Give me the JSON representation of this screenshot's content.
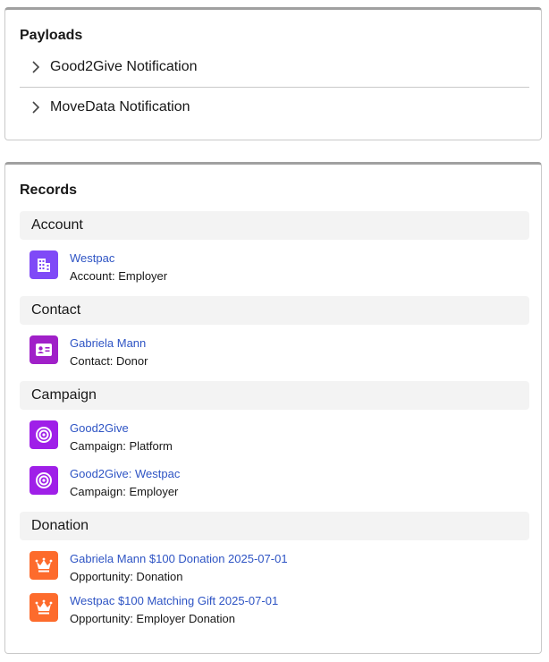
{
  "payloads": {
    "title": "Payloads",
    "items": [
      {
        "label": "Good2Give Notification"
      },
      {
        "label": "MoveData Notification"
      }
    ]
  },
  "records": {
    "title": "Records",
    "sections": [
      {
        "header": "Account",
        "items": [
          {
            "name": "Westpac",
            "subtitle": "Account: Employer",
            "icon": "building-icon",
            "color": "#7f4af7"
          }
        ]
      },
      {
        "header": "Contact",
        "items": [
          {
            "name": "Gabriela Mann",
            "subtitle": "Contact: Donor",
            "icon": "contact-card-icon",
            "color": "#a020c8"
          }
        ]
      },
      {
        "header": "Campaign",
        "items": [
          {
            "name": "Good2Give",
            "subtitle": "Campaign: Platform",
            "icon": "target-icon",
            "color": "#9f1fe8"
          },
          {
            "name": "Good2Give: Westpac",
            "subtitle": "Campaign: Employer",
            "icon": "target-icon",
            "color": "#9f1fe8"
          }
        ]
      },
      {
        "header": "Donation",
        "items": [
          {
            "name": "Gabriela Mann $100 Donation 2025-07-01",
            "subtitle": "Opportunity: Donation",
            "icon": "crown-icon",
            "color": "#fd6b2c"
          },
          {
            "name": "Westpac $100 Matching Gift 2025-07-01",
            "subtitle": "Opportunity: Employer Donation",
            "icon": "crown-icon",
            "color": "#fd6b2c"
          }
        ]
      }
    ]
  }
}
